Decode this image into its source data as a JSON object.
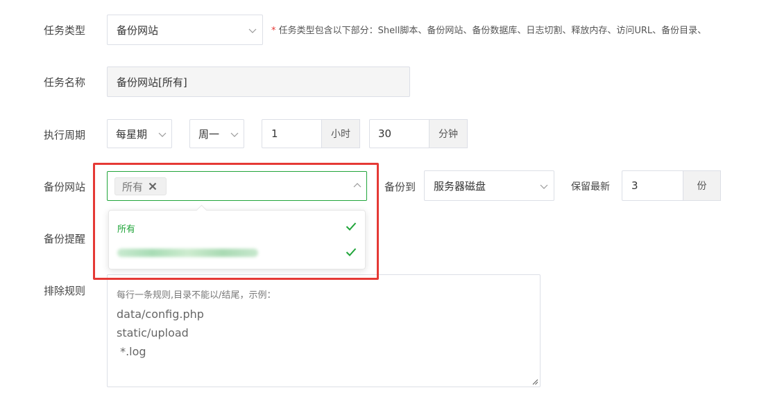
{
  "form": {
    "task_type": {
      "label": "任务类型",
      "value": "备份网站",
      "hint_star": "*",
      "hint": "任务类型包含以下部分：Shell脚本、备份网站、备份数据库、日志切割、释放内存、访问URL、备份目录、"
    },
    "task_name": {
      "label": "任务名称",
      "value": "备份网站[所有]"
    },
    "cycle": {
      "label": "执行周期",
      "period": "每星期",
      "weekday": "周一",
      "hour": "1",
      "hour_unit": "小时",
      "minute": "30",
      "minute_unit": "分钟"
    },
    "backup_site": {
      "label": "备份网站",
      "tag": "所有",
      "options": [
        {
          "label": "所有",
          "checked": true
        },
        {
          "label": "",
          "checked": true,
          "blurred": true
        }
      ]
    },
    "backup_to": {
      "label": "备份到",
      "value": "服务器磁盘"
    },
    "keep_latest": {
      "label": "保留最新",
      "value": "3",
      "unit": "份"
    },
    "reminder": {
      "label": "备份提醒"
    },
    "exclude": {
      "label": "排除规则",
      "placeholder_lines": [
        "每行一条规则,目录不能以/结尾，示例：",
        "data/config.php",
        "static/upload",
        " *.log"
      ]
    }
  },
  "colors": {
    "accent": "#20a53a",
    "highlight": "#e53935",
    "addon_bg": "#f2f2f2"
  }
}
